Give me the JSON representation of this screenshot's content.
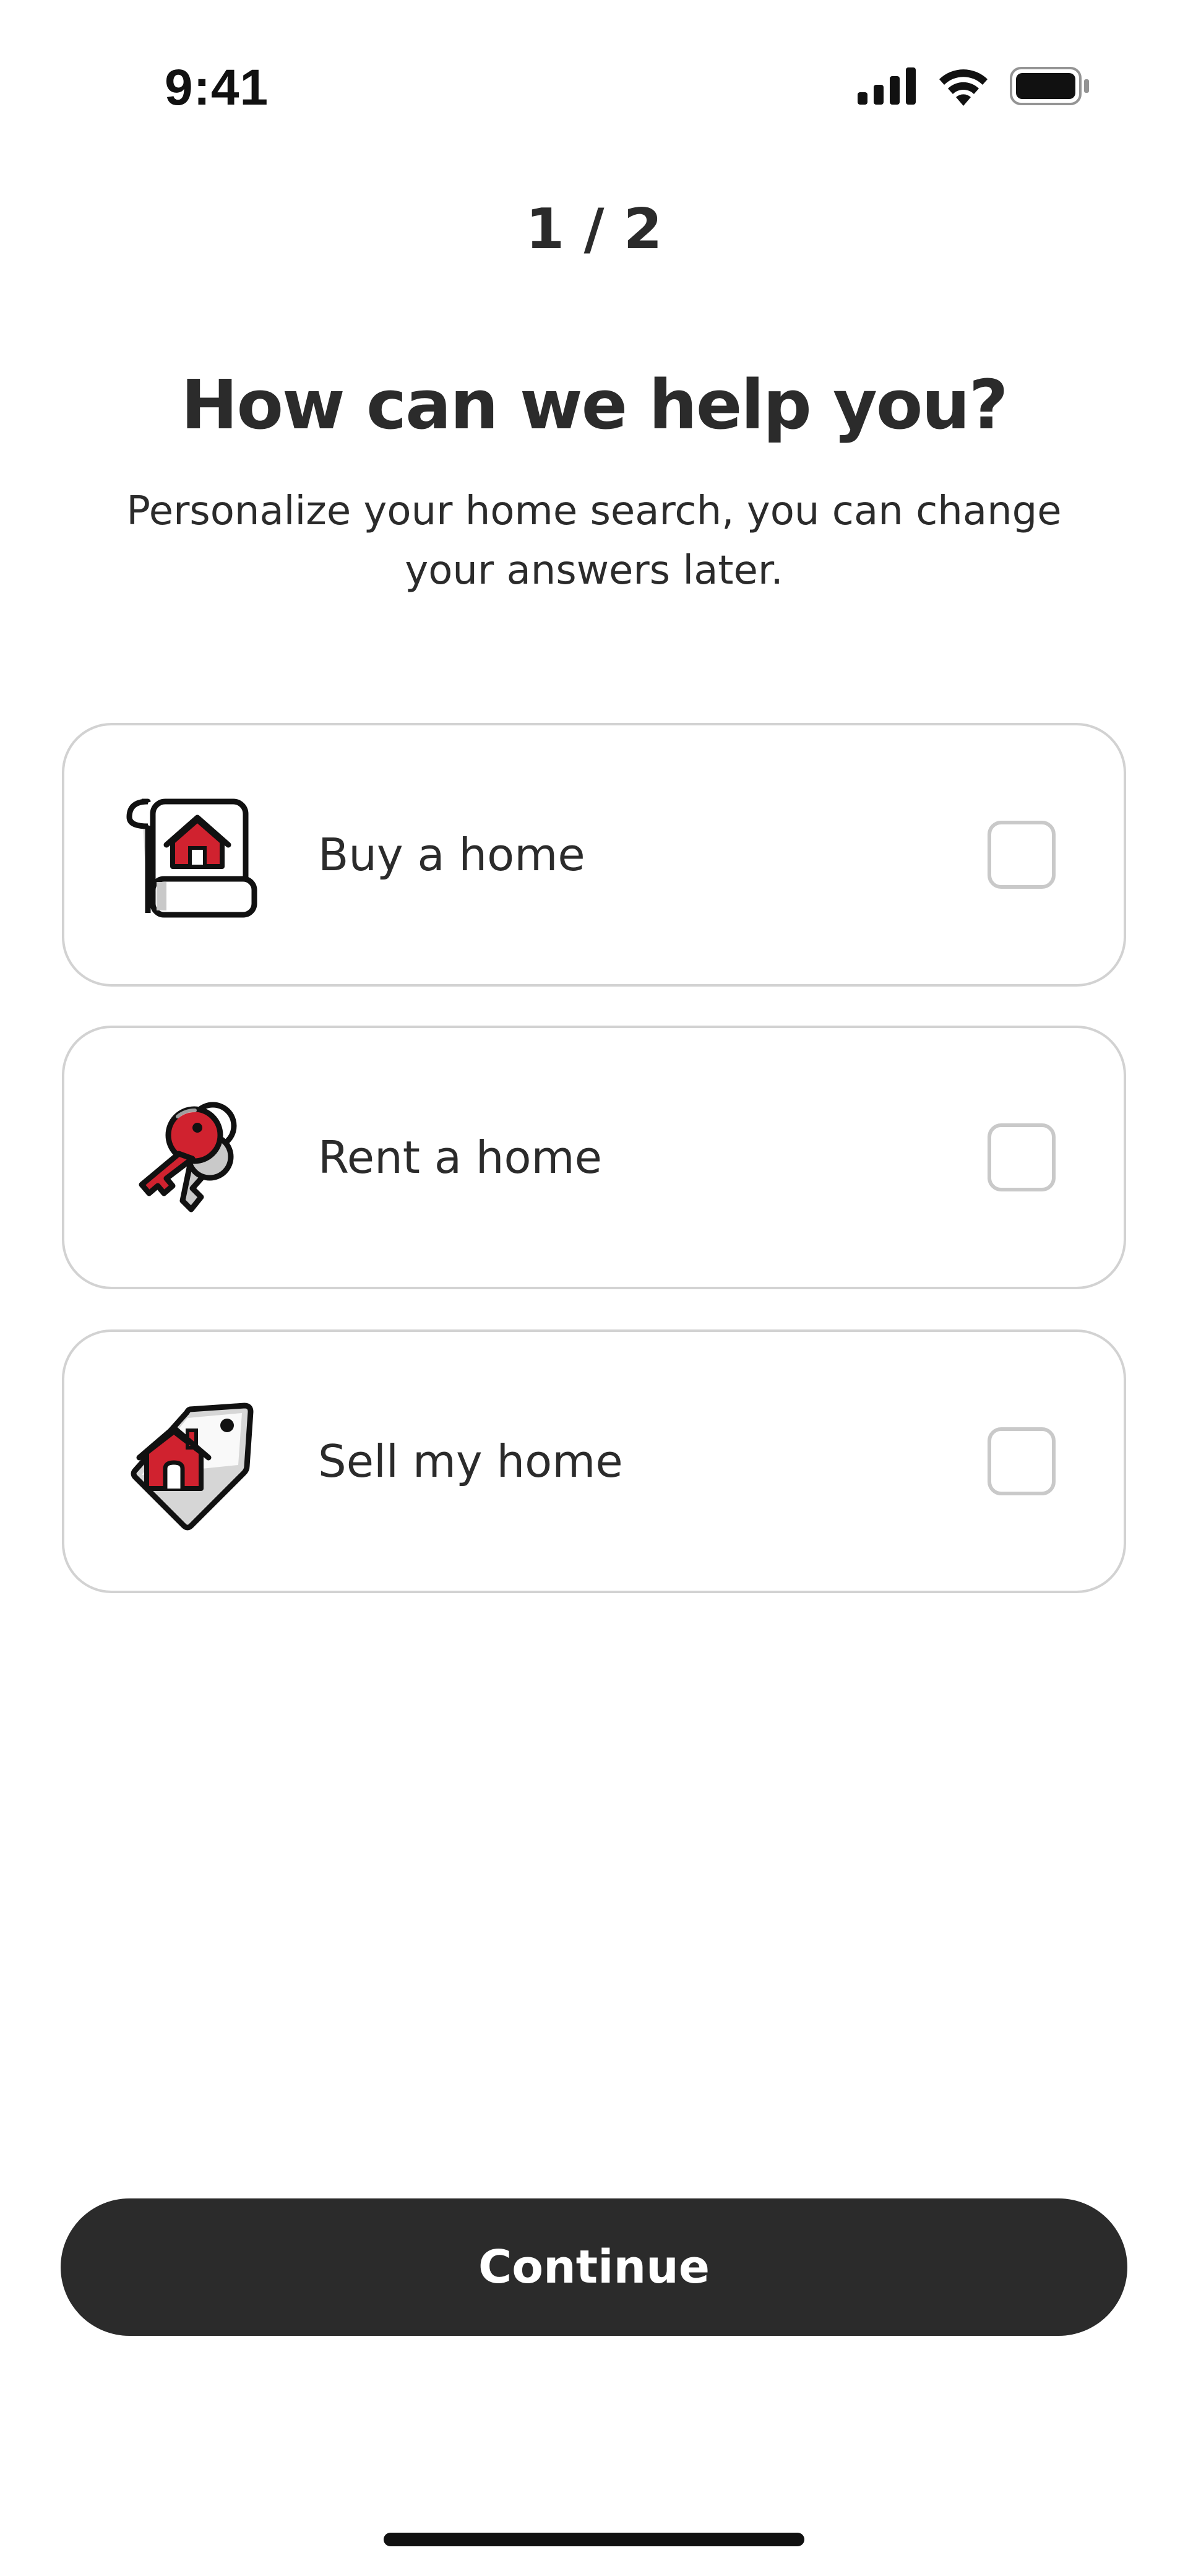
{
  "status_bar": {
    "time": "9:41",
    "icons": [
      "cellular-signal-icon",
      "wifi-icon",
      "battery-icon"
    ]
  },
  "step_indicator": "1 / 2",
  "heading": "How can we help you?",
  "subtitle": "Personalize your home search, you can change your answers later.",
  "options": [
    {
      "label": "Buy a home",
      "icon": "house-deed-scroll-icon",
      "checked": false
    },
    {
      "label": "Rent a home",
      "icon": "house-keys-icon",
      "checked": false
    },
    {
      "label": "Sell my home",
      "icon": "house-price-tag-icon",
      "checked": false
    }
  ],
  "continue_label": "Continue",
  "colors": {
    "primary_dark": "#2b2b2b",
    "accent_red": "#d0222f",
    "border_gray": "#d2d2d2"
  }
}
